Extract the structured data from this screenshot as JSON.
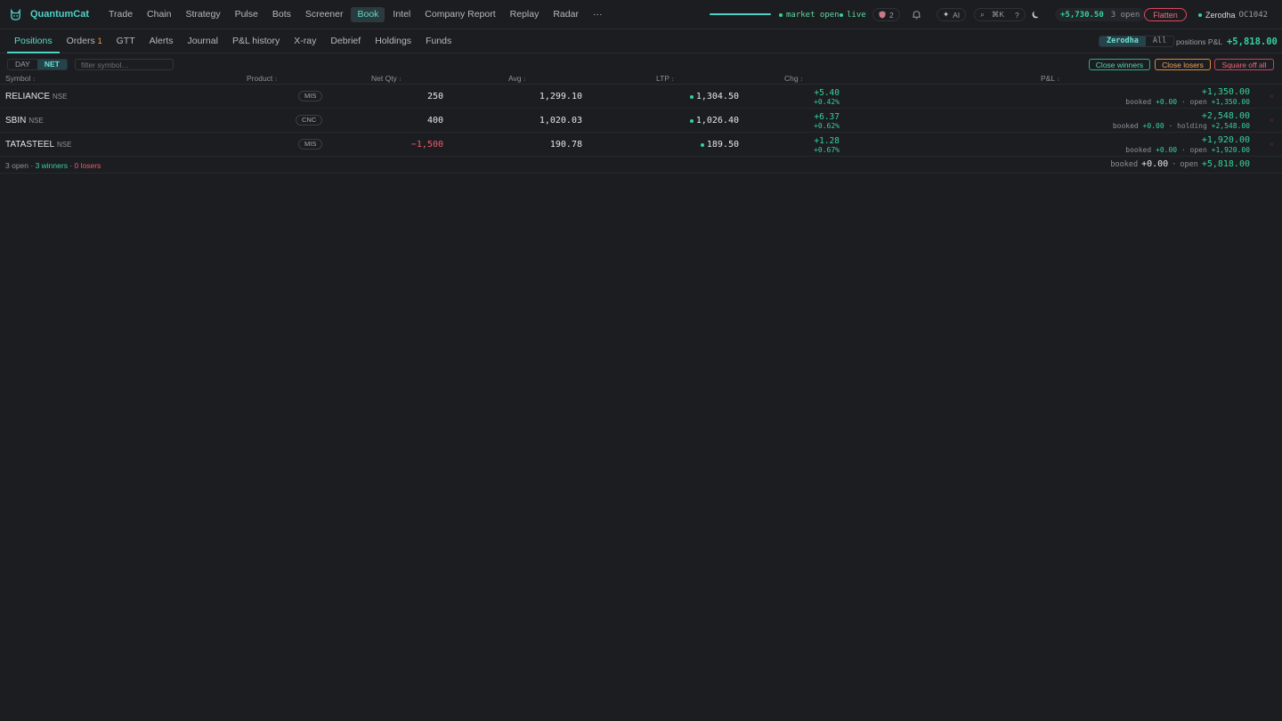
{
  "app": {
    "brand": "QuantumCat",
    "nav": [
      "Trade",
      "Chain",
      "Strategy",
      "Pulse",
      "Bots",
      "Screener",
      "Book",
      "Intel",
      "Company Report",
      "Replay",
      "Radar",
      "···"
    ],
    "active_nav": "Book",
    "status": {
      "market": "market open",
      "live": "live"
    },
    "shield_count": "2",
    "ai_label": "AI",
    "shortcut": "⌘K",
    "help": "?",
    "day_pnl": "+5,730.50",
    "open_count": "3 open",
    "flatten_label": "Flatten",
    "broker": "Zerodha",
    "user_id": "OC1042"
  },
  "subtabs": {
    "items": [
      "Positions",
      "Orders",
      "GTT",
      "Alerts",
      "Journal",
      "P&L history",
      "X-ray",
      "Debrief",
      "Holdings",
      "Funds"
    ],
    "orders_badge": "1",
    "broker_filter": [
      "Zerodha",
      "All"
    ],
    "positions_pnl_label": "positions P&L",
    "positions_pnl_value": "+5,818.00"
  },
  "filters": {
    "mode": [
      "DAY",
      "NET"
    ],
    "search_placeholder": "filter symbol…",
    "close_winners": "Close winners",
    "close_losers": "Close losers",
    "square_off_all": "Square off all"
  },
  "table": {
    "headers": [
      "Symbol",
      "Product",
      "Net Qty",
      "Avg",
      "LTP",
      "Chg",
      "P&L"
    ],
    "rows": [
      {
        "symbol": "RELIANCE",
        "exchange": "NSE",
        "product": "MIS",
        "qty": "250",
        "avg": "1,299.10",
        "ltp": "1,304.50",
        "chg": "+5.40",
        "chg_pct": "+0.42%",
        "pnl": "+1,350.00",
        "sub_a_label": "booked",
        "sub_a": "+0.00",
        "sub_b_label": "open",
        "sub_b": "+1,350.00",
        "qty_negative": false
      },
      {
        "symbol": "SBIN",
        "exchange": "NSE",
        "product": "CNC",
        "qty": "400",
        "avg": "1,020.03",
        "ltp": "1,026.40",
        "chg": "+6.37",
        "chg_pct": "+0.62%",
        "pnl": "+2,548.00",
        "sub_a_label": "booked",
        "sub_a": "+0.00",
        "sub_b_label": "holding",
        "sub_b": "+2,548.00",
        "qty_negative": false
      },
      {
        "symbol": "TATASTEEL",
        "exchange": "NSE",
        "product": "MIS",
        "qty": "−1,500",
        "avg": "190.78",
        "ltp": "189.50",
        "chg": "+1.28",
        "chg_pct": "+0.67%",
        "pnl": "+1,920.00",
        "sub_a_label": "booked",
        "sub_a": "+0.00",
        "sub_b_label": "open",
        "sub_b": "+1,920.00",
        "qty_negative": true
      }
    ],
    "close_glyph": "×"
  },
  "footer": {
    "open": "3 open",
    "winners": "3 winners",
    "losers": "0 losers",
    "booked_label": "booked",
    "booked": "+0.00",
    "open_label": "open",
    "open_value": "+5,818.00"
  }
}
